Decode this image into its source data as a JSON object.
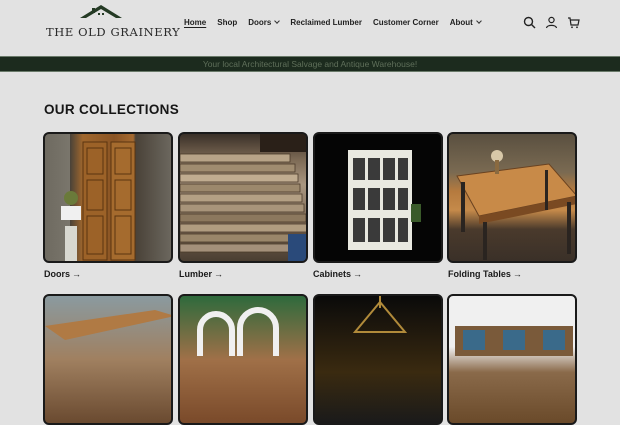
{
  "header": {
    "logo_text": "THE OLD GRAINERY",
    "nav": [
      {
        "label": "Home",
        "active": true,
        "dropdown": false
      },
      {
        "label": "Shop",
        "active": false,
        "dropdown": false
      },
      {
        "label": "Doors",
        "active": false,
        "dropdown": true
      },
      {
        "label": "Reclaimed Lumber",
        "active": false,
        "dropdown": false
      },
      {
        "label": "Customer Corner",
        "active": false,
        "dropdown": false
      },
      {
        "label": "About",
        "active": false,
        "dropdown": true
      }
    ],
    "icons": [
      "search-icon",
      "account-icon",
      "cart-icon"
    ]
  },
  "banner": {
    "text": "Your local Architectural Salvage and Antique Warehouse!"
  },
  "collections": {
    "title": "OUR COLLECTIONS",
    "items": [
      {
        "label": "Doors",
        "arrow": "→"
      },
      {
        "label": "Lumber",
        "arrow": "→"
      },
      {
        "label": "Cabinets",
        "arrow": "→"
      },
      {
        "label": "Folding Tables",
        "arrow": "→"
      }
    ]
  },
  "colors": {
    "banner_bg": "#1c2b1e",
    "page_bg": "#e2e2e2",
    "text": "#1a1a1a"
  }
}
